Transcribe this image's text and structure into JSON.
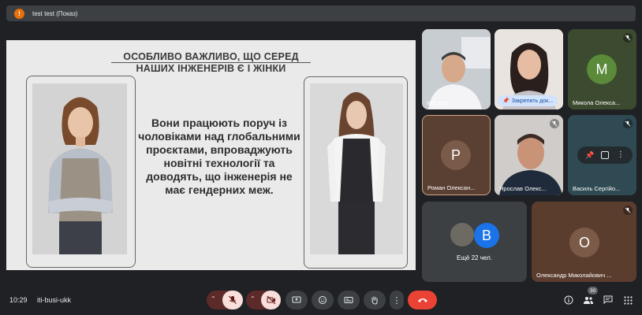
{
  "banner": {
    "badge": "!",
    "title": "test test (Показ)"
  },
  "slide": {
    "title_line1": "ОСОБЛИВО ВАЖЛИВО, ЩО СЕРЕД",
    "title_line2": "НАШИХ ІНЖЕНЕРІВ Є І ЖІНКИ",
    "body": "Вони працюють поруч із чоловіками над глобальними проєктами, впроваджують новітні технології та доводять, що інженерія не має гендерних меж."
  },
  "tiles": {
    "t1": {
      "name": "test test"
    },
    "t2": {
      "pin_label": "Закрепить док..."
    },
    "t3": {
      "initial": "M",
      "name": "Микола Олекса...",
      "avatar_color": "#5b8a3a"
    },
    "t4": {
      "initial": "P",
      "name": "Роман Олексан..."
    },
    "t5": {
      "name": "Ярослав Олекс..."
    },
    "t6": {
      "name": "Василь Сергійо..."
    },
    "t7": {
      "initial": "B",
      "more_label": "Ещё 22 чел.",
      "avatar_color": "#1a73e8"
    },
    "t8": {
      "initial": "O",
      "name": "Олександр Миколайович ..."
    }
  },
  "bottom": {
    "clock": "10:29",
    "meeting_code": "iti-busi-ukk",
    "participant_count": "30"
  }
}
